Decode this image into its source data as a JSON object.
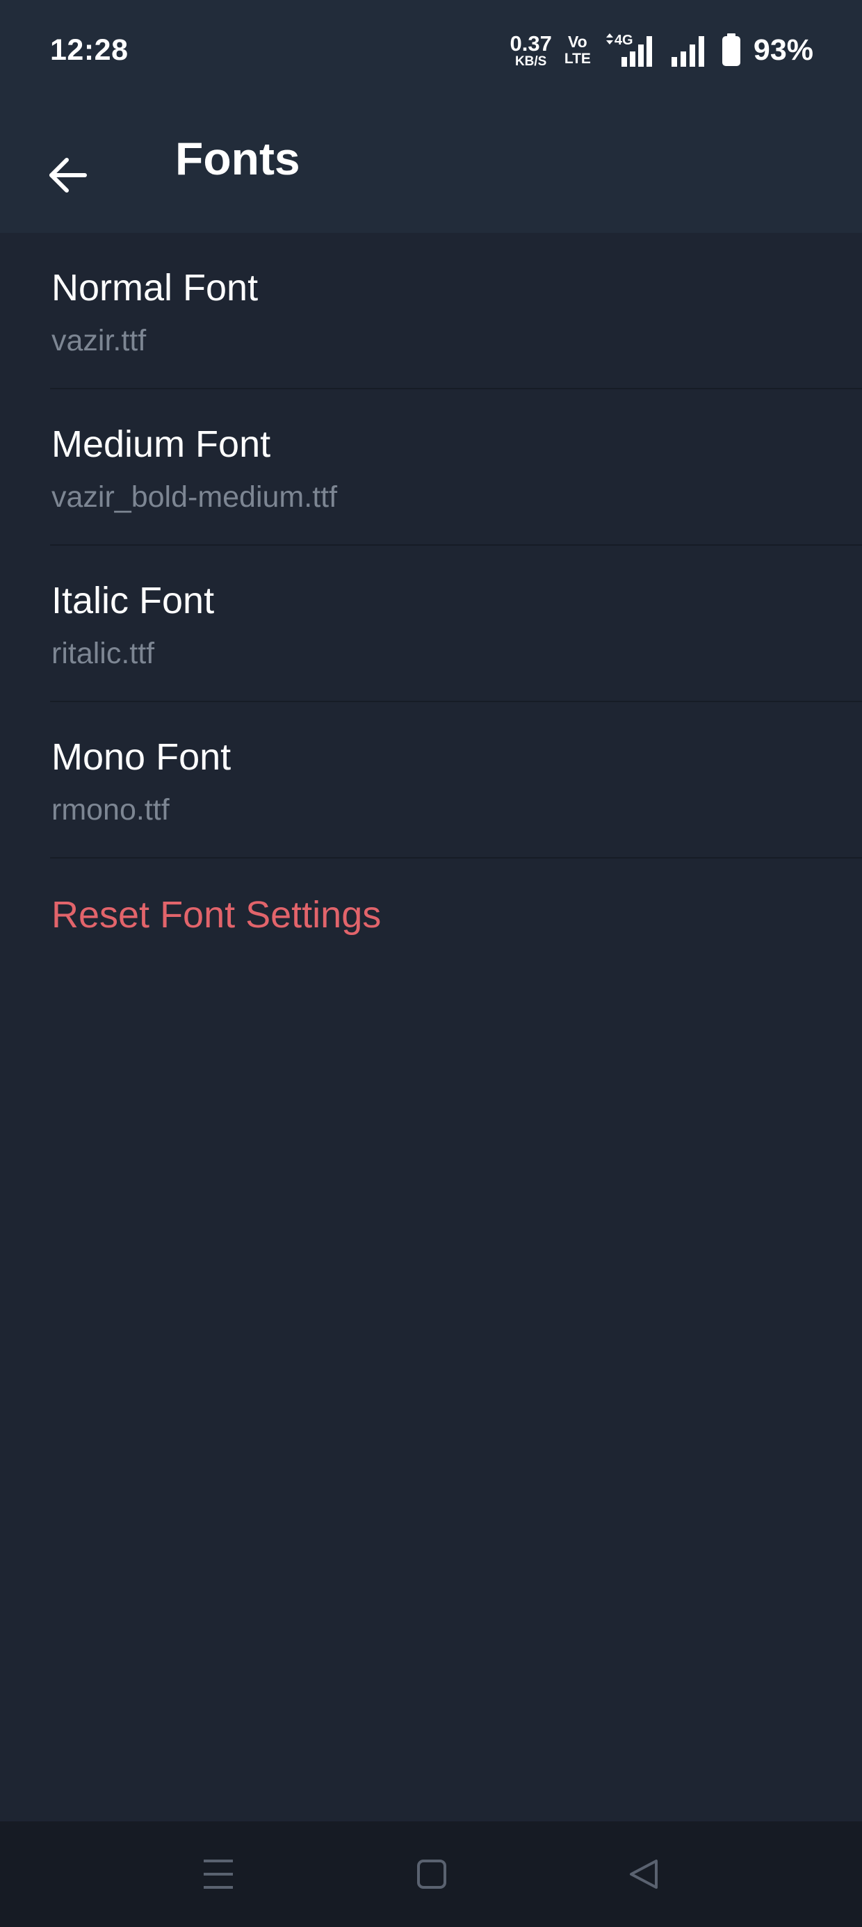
{
  "status_bar": {
    "time": "12:28",
    "net_speed_value": "0.37",
    "net_speed_unit": "KB/S",
    "volte_top": "Vo",
    "volte_bottom": "LTE",
    "network_type": "4G",
    "battery_percent": "93%"
  },
  "app_bar": {
    "back_icon": "arrow-left-icon",
    "title": "Fonts"
  },
  "fonts": [
    {
      "title": "Normal Font",
      "value": "vazir.ttf"
    },
    {
      "title": "Medium Font",
      "value": "vazir_bold-medium.ttf"
    },
    {
      "title": "Italic Font",
      "value": "ritalic.ttf"
    },
    {
      "title": "Mono Font",
      "value": "rmono.ttf"
    }
  ],
  "reset": {
    "label": "Reset Font Settings"
  },
  "nav_bar": {
    "icons": [
      "menu-icon",
      "home-icon",
      "back-triangle-icon"
    ]
  },
  "colors": {
    "background": "#1e2532",
    "app_bar": "#222c3a",
    "primary_text": "#ffffff",
    "secondary_text": "#7d8693",
    "destructive": "#e2646b",
    "nav_bar": "#161b24"
  }
}
